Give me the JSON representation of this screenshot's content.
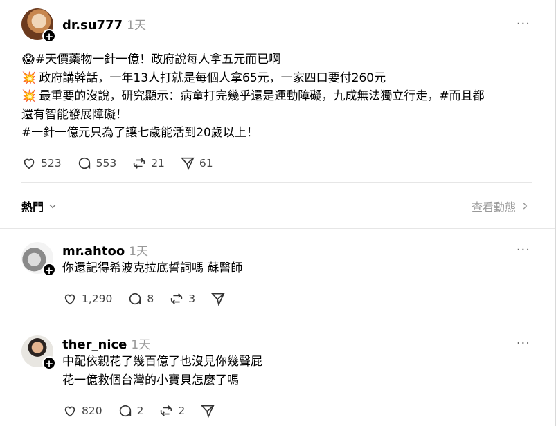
{
  "main_post": {
    "username": "dr.su777",
    "time": "1天",
    "more": "···",
    "lines": [
      {
        "emoji": "😱",
        "text": "#天價藥物一針一億！政府說每人拿五元而已啊"
      },
      {
        "emoji": "💥",
        "text": " 政府講幹話，一年13人打就是每個人拿65元，一家四口要付260元"
      },
      {
        "emoji": "💥",
        "text": " 最重要的沒說，研究顯示：病童打完幾乎還是運動障礙，九成無法獨立行走，#而且都"
      },
      {
        "emoji": "",
        "text": "還有智能發展障礙！"
      },
      {
        "emoji": "",
        "text": "#一針一億元只為了讓七歲能活到20歲以上！"
      }
    ],
    "likes": "523",
    "comments": "553",
    "reposts": "21",
    "shares": "61"
  },
  "sort": {
    "label": "熱門",
    "view_activity": "查看動態"
  },
  "replies": [
    {
      "username": "mr.ahtoo",
      "time": "1天",
      "lines": [
        "你還記得希波克拉底誓詞嗎 蘇醫師"
      ],
      "likes": "1,290",
      "comments": "8",
      "reposts": "3",
      "shares": ""
    },
    {
      "username": "ther_nice",
      "time": "1天",
      "lines": [
        "中配依親花了幾百億了也沒見你幾聲屁",
        "花一億救個台灣的小寶貝怎麼了嗎"
      ],
      "likes": "820",
      "comments": "2",
      "reposts": "2",
      "shares": ""
    }
  ]
}
